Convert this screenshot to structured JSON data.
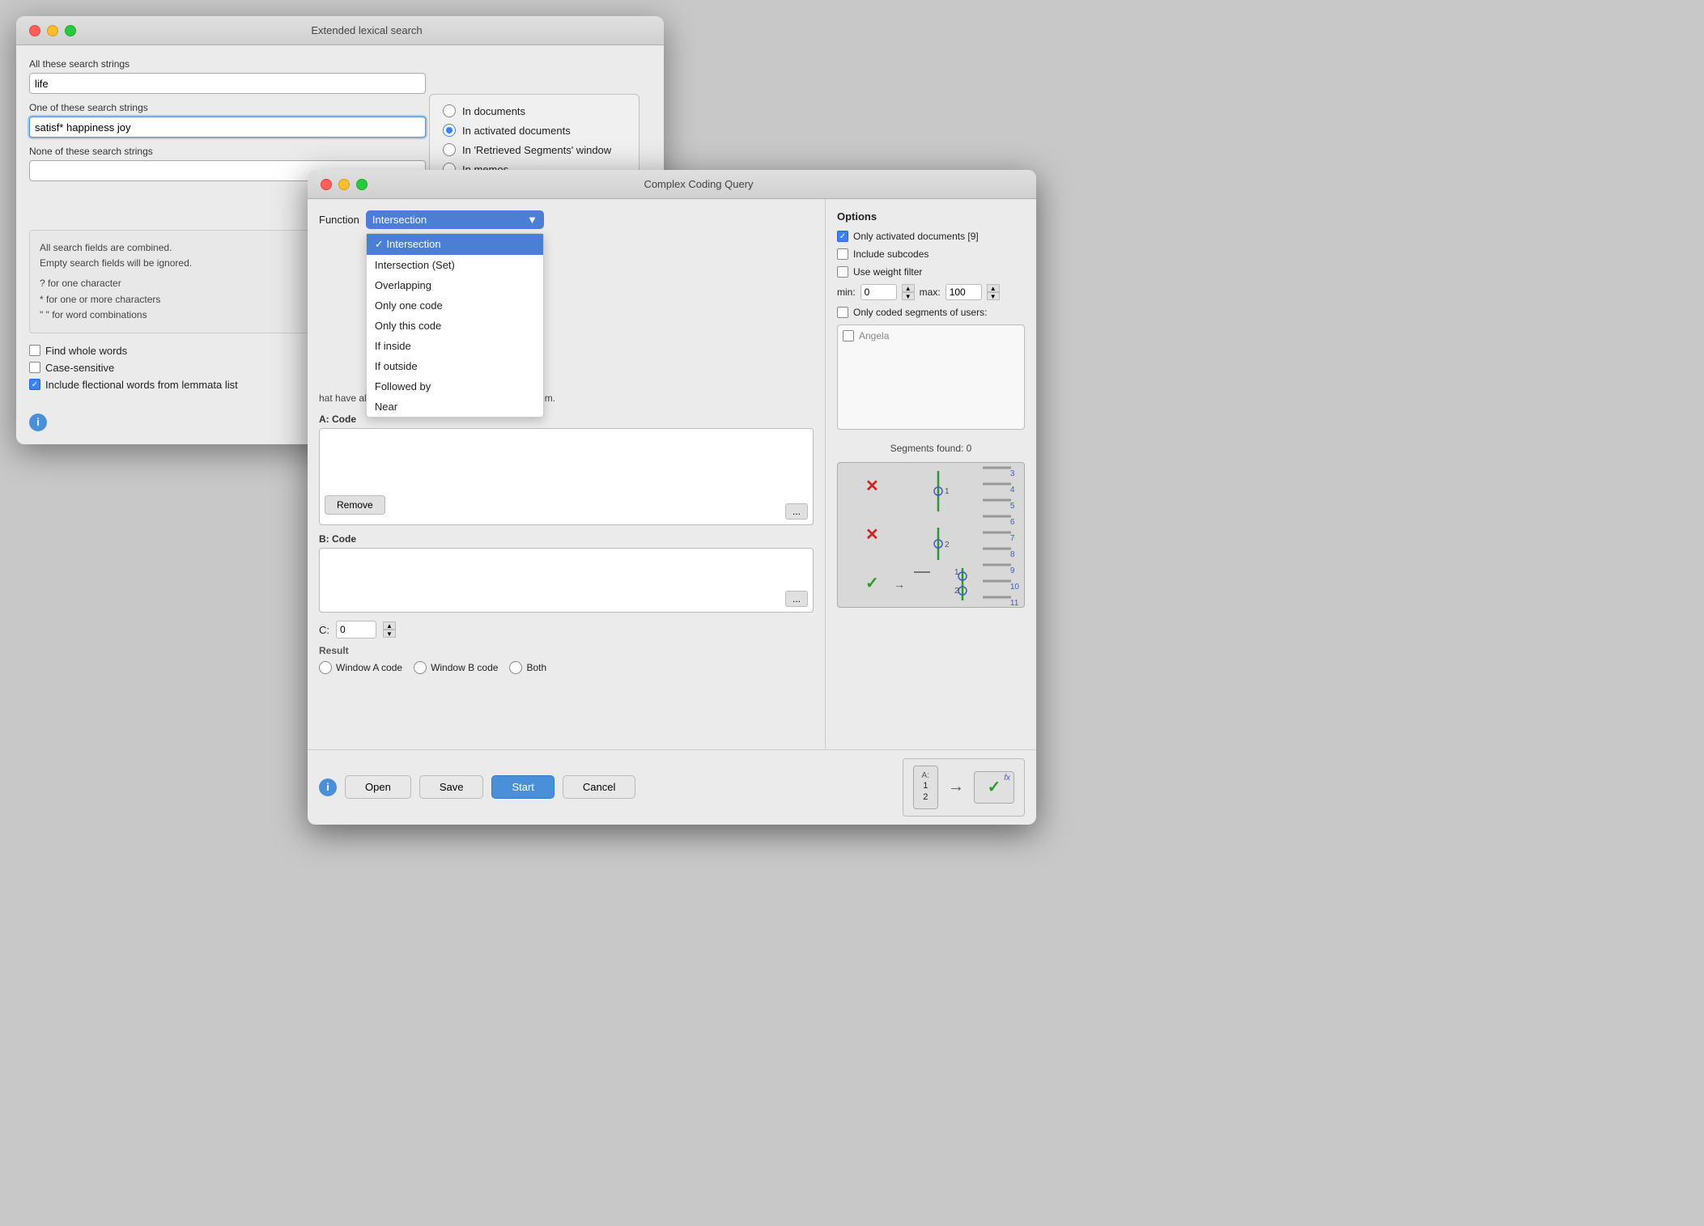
{
  "lexical_window": {
    "title": "Extended lexical search",
    "fields": {
      "all_strings_label": "All these search strings",
      "all_strings_value": "life",
      "one_string_label": "One of these search strings",
      "one_string_value": "satisf* happiness joy",
      "none_string_label": "None of these search strings",
      "none_string_value": ""
    },
    "radio_options": [
      {
        "label": "In documents",
        "selected": false
      },
      {
        "label": "In activated documents",
        "selected": true
      },
      {
        "label": "In 'Retrieved Segments' window",
        "selected": false
      },
      {
        "label": "In memos",
        "selected": false
      }
    ],
    "help": {
      "line1": "All search fields are combined.",
      "line2": "Empty search fields will be ignored.",
      "line3": "?  for one character",
      "line4": "*  for one or more characters",
      "line5": "\" \"  for word combinations"
    },
    "checkboxes": [
      {
        "label": "Find whole words",
        "checked": false
      },
      {
        "label": "Case-sensitive",
        "checked": false
      },
      {
        "label": "Include flectional words from lemmata list",
        "checked": true
      }
    ]
  },
  "ccq_window": {
    "title": "Complex Coding Query",
    "function_label": "Function",
    "function_selected": "Intersection",
    "function_options": [
      "Intersection",
      "Intersection (Set)",
      "Overlapping",
      "Only one code",
      "Only this code",
      "If inside",
      "If outside",
      "Followed by",
      "Near"
    ],
    "description": "hat have all of the codes listed in \"A\" assigned to them.",
    "code_area_a_label": "A: Code",
    "code_area_b_label": "B: Code",
    "code_area_c_label": "C:",
    "c_value": "0",
    "remove_label": "Remove",
    "dots_label": "...",
    "result_label": "Result",
    "result_options": [
      {
        "label": "Window A code",
        "selected": false
      },
      {
        "label": "Window B code",
        "selected": false
      },
      {
        "label": "Both",
        "selected": false
      }
    ],
    "options": {
      "title": "Options",
      "only_activated": "Only activated documents [9]",
      "only_activated_checked": true,
      "include_subcodes": "Include subcodes",
      "include_subcodes_checked": false,
      "use_weight": "Use weight filter",
      "use_weight_checked": false,
      "weight_min": "0",
      "weight_max": "100",
      "only_coded_segments": "Only coded segments of users:",
      "only_coded_checked": false,
      "users": [
        "Angela"
      ]
    },
    "segments_found": "Segments found: 0",
    "footer": {
      "info_label": "i",
      "open_label": "Open",
      "save_label": "Save",
      "start_label": "Start",
      "cancel_label": "Cancel"
    }
  },
  "viz": {
    "numbers": [
      "3",
      "4",
      "5",
      "6",
      "7",
      "8",
      "9",
      "10",
      "11"
    ],
    "markers": [
      {
        "type": "red-x",
        "pos": 1
      },
      {
        "type": "red-x",
        "pos": 2
      },
      {
        "type": "green-check",
        "pos": 3
      }
    ]
  },
  "diagram": {
    "a_label": "A:",
    "a_values": "1\n2",
    "arrow": "→",
    "fx_label": "fx",
    "check": "✓"
  }
}
